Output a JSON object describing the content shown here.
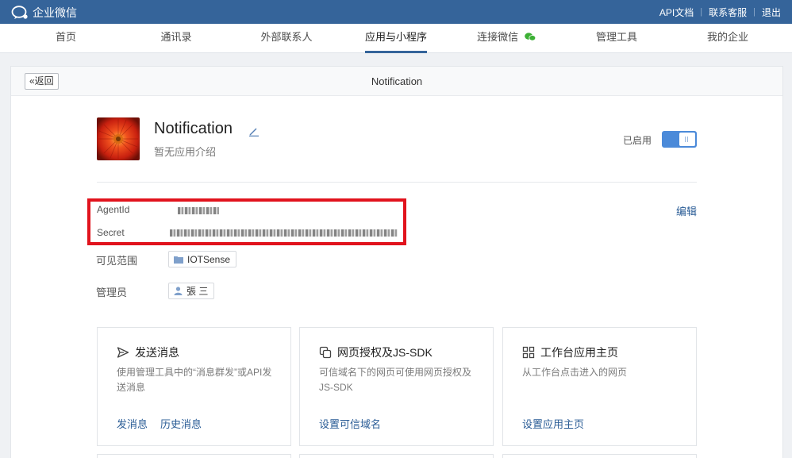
{
  "topbar": {
    "logo_text": "企业微信",
    "links": [
      "API文档",
      "联系客服",
      "退出"
    ]
  },
  "nav": {
    "items": [
      "首页",
      "通讯录",
      "外部联系人",
      "应用与小程序",
      "连接微信",
      "管理工具",
      "我的企业"
    ],
    "active": "应用与小程序"
  },
  "page": {
    "back_label": "«返回",
    "title": "Notification"
  },
  "app": {
    "name": "Notification",
    "description": "暂无应用介绍",
    "enable_label": "已启用",
    "enabled": true
  },
  "fields": {
    "agentid_label": "AgentId",
    "secret_label": "Secret",
    "edit_label": "编辑",
    "visible_label": "可见范围",
    "visible_value": "IOTSense",
    "admin_label": "管理员",
    "admin_value": "張 三"
  },
  "panels": [
    {
      "title": "发送消息",
      "icon": "send-icon",
      "desc": "使用管理工具中的“消息群发”或API发送消息",
      "links": [
        "发消息",
        "历史消息"
      ]
    },
    {
      "title": "网页授权及JS-SDK",
      "icon": "copy-icon",
      "desc": "可信域名下的网页可使用网页授权及JS-SDK",
      "links": [
        "设置可信域名"
      ]
    },
    {
      "title": "工作台应用主页",
      "icon": "grid-icon",
      "desc": "从工作台点击进入的网页",
      "links": [
        "设置应用主页"
      ]
    }
  ],
  "colors": {
    "topbar": "#35649a",
    "link": "#2a5c96",
    "highlight": "#e1131d",
    "toggle": "#4b8ad9"
  }
}
